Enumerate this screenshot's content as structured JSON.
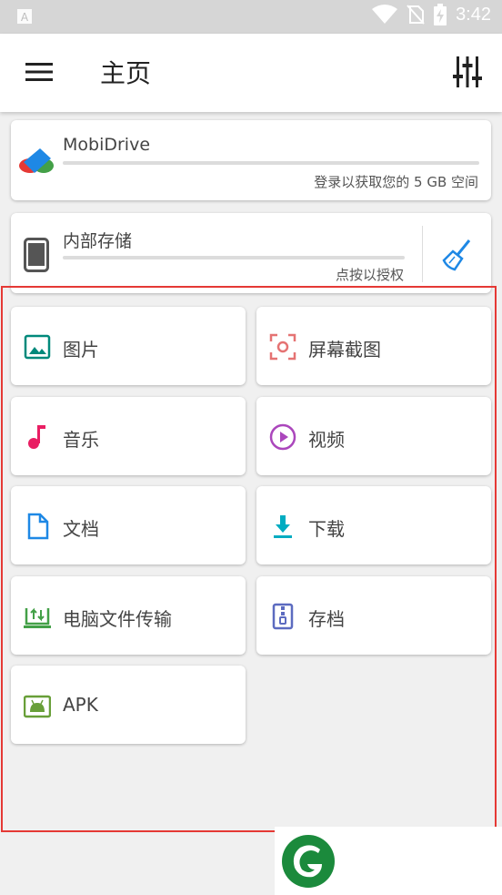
{
  "status_bar": {
    "time": "3:42",
    "icons": [
      "a-notification-icon",
      "wifi-icon",
      "no-sim-icon",
      "battery-charging-icon"
    ]
  },
  "app_bar": {
    "title": "主页",
    "menu_icon": "menu-icon",
    "tune_icon": "tune-icon"
  },
  "storage": {
    "cloud": {
      "name": "MobiDrive",
      "subtitle": "登录以获取您的 5 GB 空间",
      "progress": 0,
      "icon": "mobidrive-logo"
    },
    "internal": {
      "name": "内部存储",
      "subtitle": "点按以授权",
      "progress": 0,
      "icon": "phone-icon",
      "action_icon": "broom-icon"
    }
  },
  "categories": [
    {
      "label": "图片",
      "icon": "image-icon",
      "color": "#00897b"
    },
    {
      "label": "屏幕截图",
      "icon": "screenshot-icon",
      "color": "#e57373"
    },
    {
      "label": "音乐",
      "icon": "music-note-icon",
      "color": "#e91e63"
    },
    {
      "label": "视频",
      "icon": "play-circle-icon",
      "color": "#ab47bc"
    },
    {
      "label": "文档",
      "icon": "document-icon",
      "color": "#1e88e5"
    },
    {
      "label": "下载",
      "icon": "download-icon",
      "color": "#00acc1"
    },
    {
      "label": "电脑文件传输",
      "icon": "pc-transfer-icon",
      "color": "#43a047"
    },
    {
      "label": "存档",
      "icon": "archive-icon",
      "color": "#5c6bc0"
    },
    {
      "label": "APK",
      "icon": "android-icon",
      "color": "#689f38"
    }
  ],
  "colors": {
    "highlight": "#e53935",
    "logo_green": "#1b8a3c"
  }
}
